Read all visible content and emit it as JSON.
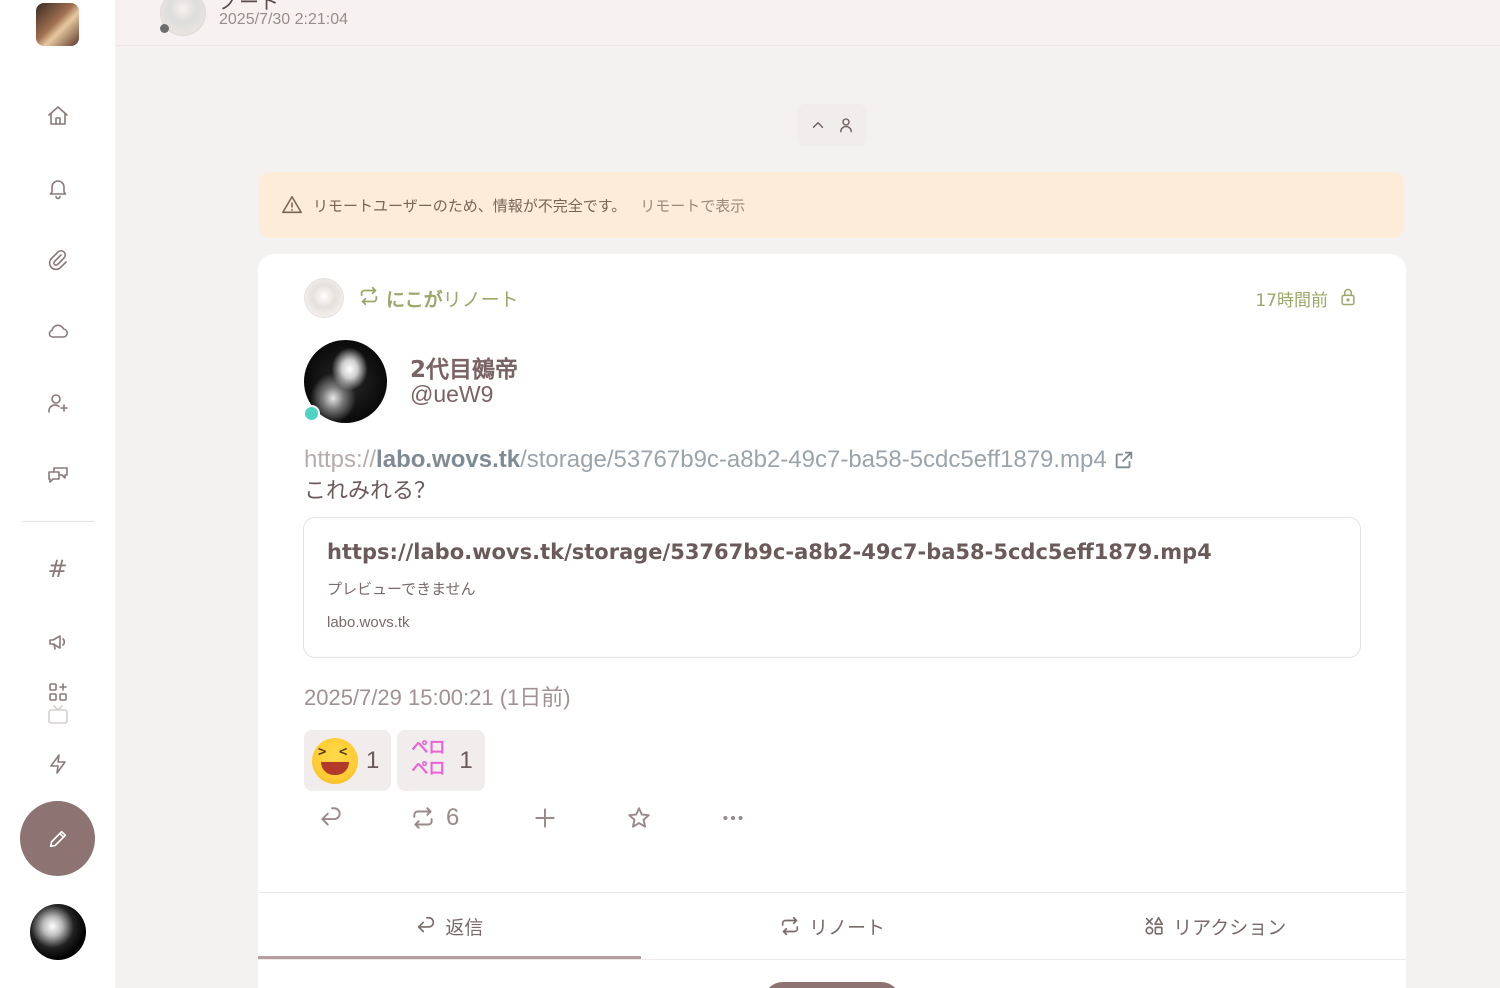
{
  "header": {
    "title": "ノート",
    "datetime": "2025/7/30 2:21:04"
  },
  "sidebar": {
    "items": [
      {
        "name": "home",
        "icon": "home-icon"
      },
      {
        "name": "notifications",
        "icon": "bell-icon"
      },
      {
        "name": "clips",
        "icon": "paperclip-icon"
      },
      {
        "name": "drive",
        "icon": "cloud-icon"
      },
      {
        "name": "follow-requests",
        "icon": "user-plus-icon"
      },
      {
        "name": "chat",
        "icon": "chat-icon"
      },
      {
        "name": "hashtags",
        "label": "#"
      },
      {
        "name": "announcements",
        "icon": "megaphone-icon"
      },
      {
        "name": "widgets",
        "icon": "apps-add-icon"
      },
      {
        "name": "flash",
        "icon": "bolt-icon"
      }
    ],
    "compose_icon": "pencil-icon"
  },
  "warning": {
    "text": "リモートユーザーのため、情報が不完全です。",
    "link": "リモートで表示"
  },
  "note": {
    "renote_by": "にこが",
    "renote_suffix": "リノート",
    "renote_time": "17時間前",
    "author": {
      "name": "2代目鵺帝",
      "handle": "@ueW9",
      "online_color": "#4fd3c4"
    },
    "url": {
      "scheme": "https://",
      "host": "labo.wovs.tk",
      "path": "/storage/53767b9c-a8b2-49c7-ba58-5cdc5eff1879.mp4"
    },
    "body": "これみれる？",
    "preview": {
      "title": "https://labo.wovs.tk/storage/53767b9c-a8b2-49c7-ba58-5cdc5eff1879.mp4",
      "description": "プレビューできません",
      "site": "labo.wovs.tk"
    },
    "date": "2025/7/29 15:00:21 (1日前)",
    "reactions": [
      {
        "emoji": "laughing-emoji",
        "count": "1"
      },
      {
        "emoji": "ペロペロ",
        "count": "1"
      }
    ],
    "renote_count": "6"
  },
  "tabs": [
    {
      "label": "返信",
      "icon": "reply-icon",
      "active": true
    },
    {
      "label": "リノート",
      "icon": "repeat-icon",
      "active": false
    },
    {
      "label": "リアクション",
      "icon": "reaction-icon",
      "active": false
    }
  ],
  "colors": {
    "accent": "#8e7373",
    "renote_green": "#9aa86a",
    "warning_bg": "#fdecd7",
    "reaction_pero": "#ea62d4"
  }
}
